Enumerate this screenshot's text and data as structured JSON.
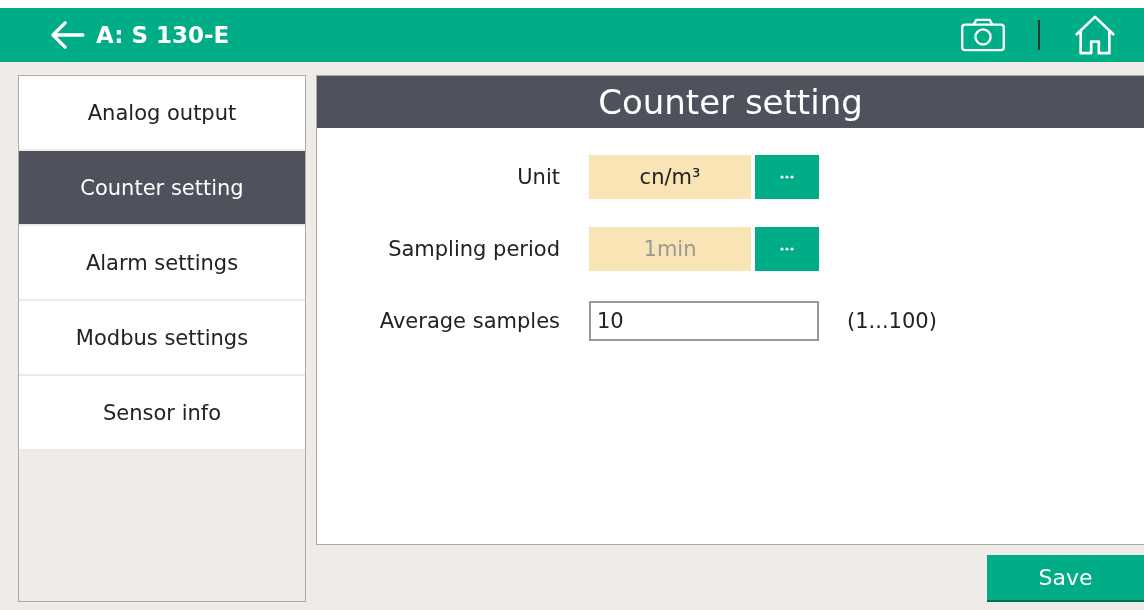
{
  "header": {
    "title": "A: S 130-E"
  },
  "sidebar": {
    "items": [
      {
        "label": "Analog output",
        "selected": false
      },
      {
        "label": "Counter setting",
        "selected": true
      },
      {
        "label": "Alarm settings",
        "selected": false
      },
      {
        "label": "Modbus settings",
        "selected": false
      },
      {
        "label": "Sensor info",
        "selected": false
      }
    ]
  },
  "panel": {
    "title": "Counter setting",
    "fields": [
      {
        "kind": "picker",
        "label": "Unit",
        "value": "cn/m³",
        "disabled": false
      },
      {
        "kind": "picker",
        "label": "Sampling period",
        "value": "1min",
        "disabled": true
      },
      {
        "kind": "input",
        "label": "Average samples",
        "value": "10",
        "range": "(1...100)"
      }
    ]
  },
  "buttons": [
    "Save"
  ]
}
